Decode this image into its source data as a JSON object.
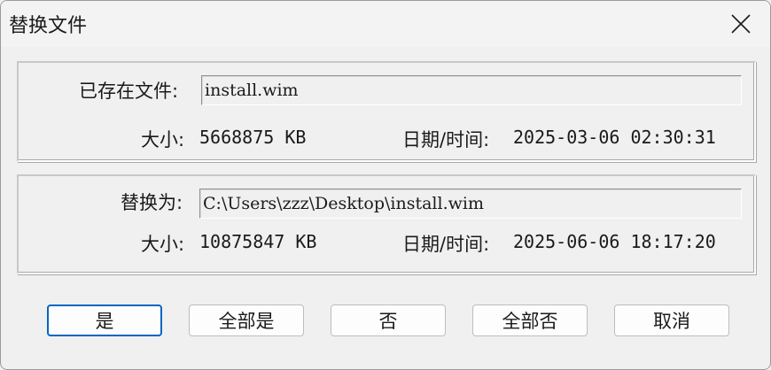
{
  "window": {
    "title": "替换文件"
  },
  "existing": {
    "file_label": "已存在文件:",
    "file_value": "install.wim",
    "size_label": "大小:",
    "size_value": "5668875 KB",
    "date_label": "日期/时间:",
    "date_value": "2025-03-06 02:30:31"
  },
  "replacement": {
    "file_label": "替换为:",
    "file_value": "C:\\Users\\zzz\\Desktop\\install.wim",
    "size_label": "大小:",
    "size_value": "10875847 KB",
    "date_label": "日期/时间:",
    "date_value": "2025-06-06 18:17:20"
  },
  "buttons": {
    "yes": "是",
    "yes_all": "全部是",
    "no": "否",
    "no_all": "全部否",
    "cancel": "取消"
  },
  "icons": {
    "close": "close-icon"
  },
  "colors": {
    "default_button_border": "#0067c0",
    "background": "#f0f0f0"
  }
}
